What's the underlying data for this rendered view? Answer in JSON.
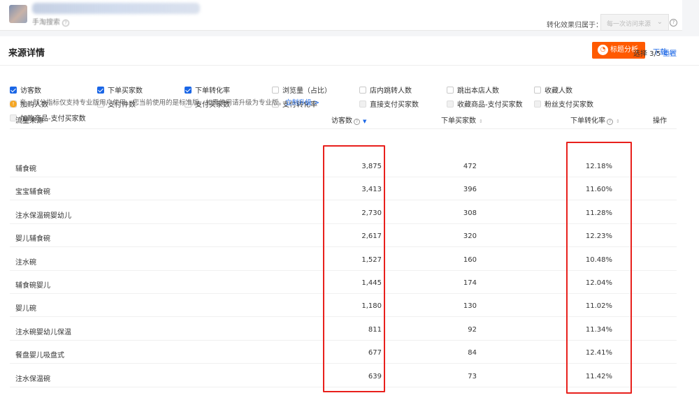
{
  "header": {
    "breadcrumb": "手淘搜索",
    "attribution_label": "转化效果归属于：",
    "attribution_value": "每一次访问来源"
  },
  "section": {
    "title": "来源详情",
    "analyze_button": "标题分析",
    "download": "下载"
  },
  "metrics": [
    {
      "label": "访客数",
      "checked": true
    },
    {
      "label": "下单买家数",
      "checked": true
    },
    {
      "label": "下单转化率",
      "checked": true
    },
    {
      "label": "浏览量（占比）",
      "checked": false
    },
    {
      "label": "店内跳转人数",
      "checked": false
    },
    {
      "label": "跳出本店人数",
      "checked": false
    },
    {
      "label": "收藏人数",
      "checked": false
    },
    {
      "label": "加购人数",
      "checked": false
    },
    {
      "label": "支付件数",
      "checked": false
    },
    {
      "label": "支付买家数",
      "checked": false
    },
    {
      "label": "支付转化率",
      "checked": false
    },
    {
      "label": "直接支付买家数",
      "checked": false,
      "disabled": true
    },
    {
      "label": "收藏商品-支付买家数",
      "checked": false,
      "disabled": true
    },
    {
      "label": "粉丝支付买家数",
      "checked": false,
      "disabled": true
    },
    {
      "label": "加购商品-支付买家数",
      "checked": false,
      "disabled": true
    }
  ],
  "selection": {
    "text": "选择 3/5",
    "reset": "重置"
  },
  "notice": {
    "text": "亲，部分指标仅支持专业版用户使用，您当前使用的是标准版，如需使用请升级为专业版。",
    "link": "立刻升级 >"
  },
  "table": {
    "headers": {
      "source": "流量来源",
      "visitors": "访客数",
      "buyers": "下单买家数",
      "rate": "下单转化率",
      "action": "操作"
    },
    "rows": [
      {
        "source": "辅食碗",
        "visitors": "3,875",
        "buyers": "472",
        "rate": "12.18%"
      },
      {
        "source": "宝宝辅食碗",
        "visitors": "3,413",
        "buyers": "396",
        "rate": "11.60%"
      },
      {
        "source": "注水保温碗婴幼儿",
        "visitors": "2,730",
        "buyers": "308",
        "rate": "11.28%"
      },
      {
        "source": "婴儿辅食碗",
        "visitors": "2,617",
        "buyers": "320",
        "rate": "12.23%"
      },
      {
        "source": "注水碗",
        "visitors": "1,527",
        "buyers": "160",
        "rate": "10.48%"
      },
      {
        "source": "辅食碗婴儿",
        "visitors": "1,445",
        "buyers": "174",
        "rate": "12.04%"
      },
      {
        "source": "婴儿碗",
        "visitors": "1,180",
        "buyers": "130",
        "rate": "11.02%"
      },
      {
        "source": "注水碗婴幼儿保温",
        "visitors": "811",
        "buyers": "92",
        "rate": "11.34%"
      },
      {
        "source": "餐盘婴儿吸盘式",
        "visitors": "677",
        "buyers": "84",
        "rate": "12.41%"
      },
      {
        "source": "注水保温碗",
        "visitors": "639",
        "buyers": "73",
        "rate": "11.42%"
      }
    ]
  },
  "colors": {
    "accent": "#1a66e6",
    "brand_orange": "#ff5a00",
    "highlight": "#e8201c"
  }
}
